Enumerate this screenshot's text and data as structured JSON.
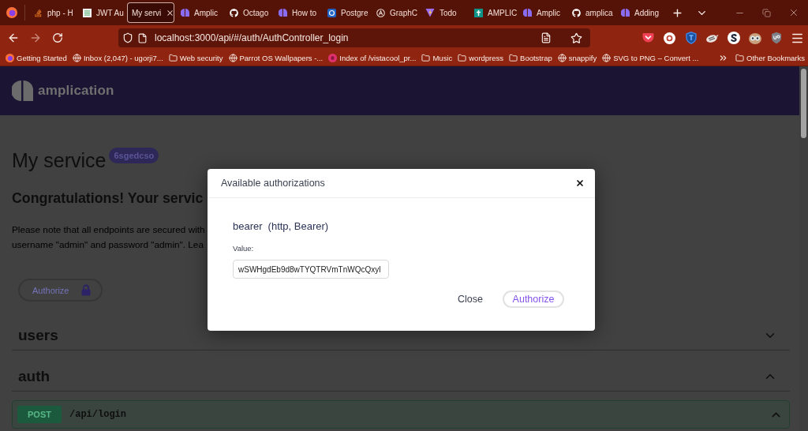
{
  "browser": {
    "tabs": [
      {
        "title": "php - H",
        "selected": false
      },
      {
        "title": "JWT Au",
        "selected": false
      },
      {
        "title": "My servi",
        "selected": true
      },
      {
        "title": "Amplic",
        "selected": false
      },
      {
        "title": "Octago",
        "selected": false
      },
      {
        "title": "How to",
        "selected": false
      },
      {
        "title": "Postgre",
        "selected": false
      },
      {
        "title": "GraphC",
        "selected": false
      },
      {
        "title": "Todo",
        "selected": false
      },
      {
        "title": "AMPLIC",
        "selected": false
      },
      {
        "title": "Amplic",
        "selected": false
      },
      {
        "title": "amplica",
        "selected": false
      },
      {
        "title": "Adding",
        "selected": false
      }
    ],
    "back_button": {
      "disabled": false
    },
    "forward_button": {
      "disabled": true
    },
    "address_bar": {
      "url": "localhost:3000/api/#/auth/AuthController_login"
    },
    "bookmarks": [
      {
        "label": "Getting Started"
      },
      {
        "label": "Inbox (2,047) - ugorji7..."
      },
      {
        "label": "Web security"
      },
      {
        "label": "Parrot OS Wallpapers -..."
      },
      {
        "label": "Index of /vistacool_pr..."
      },
      {
        "label": "Music"
      },
      {
        "label": "wordpress"
      },
      {
        "label": "Bootstrap"
      },
      {
        "label": "snappify"
      },
      {
        "label": "SVG to PNG – Convert ..."
      }
    ],
    "other_bookmarks": "Other Bookmarks"
  },
  "page": {
    "brand": "amplication",
    "title": "My service",
    "badge": "6sgedcso",
    "heading": "Congratulations! Your servic",
    "notice": "Please note that all endpoints are secured with\nusername \"admin\" and password \"admin\". Lea",
    "authorize_button": "Authorize",
    "sections": [
      {
        "name": "users",
        "expanded": false
      },
      {
        "name": "auth",
        "expanded": true,
        "operations": [
          {
            "method": "POST",
            "path": "/api/login",
            "expanded": true
          }
        ]
      }
    ]
  },
  "dialog": {
    "title": "Available authorizations",
    "scheme_name": "bearer",
    "scheme_type": "(http, Bearer)",
    "value_label": "Value:",
    "value": "wSWHgdEb9d8wTYQTRVmTnWQcQxyl",
    "buttons": [
      {
        "label": "Close",
        "kind": "text"
      },
      {
        "label": "Authorize",
        "kind": "outline"
      }
    ]
  }
}
